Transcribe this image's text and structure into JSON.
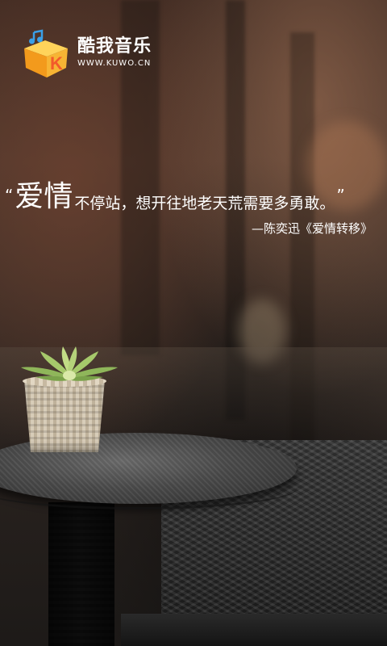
{
  "app": {
    "name": "酷我音乐",
    "url": "WWW.KUWO.CN",
    "logo_letter": "K"
  },
  "splash": {
    "quote_open": "“",
    "quote_emphasis": "爱情",
    "quote_rest": "不停站，想开往地老天荒需要多勇敢。",
    "quote_close": "”",
    "attribution": "—陈奕迅《爱情转移》"
  },
  "colors": {
    "logo_orange": "#f7a21b",
    "logo_blue": "#3aa0e8",
    "text": "#ffffff"
  }
}
